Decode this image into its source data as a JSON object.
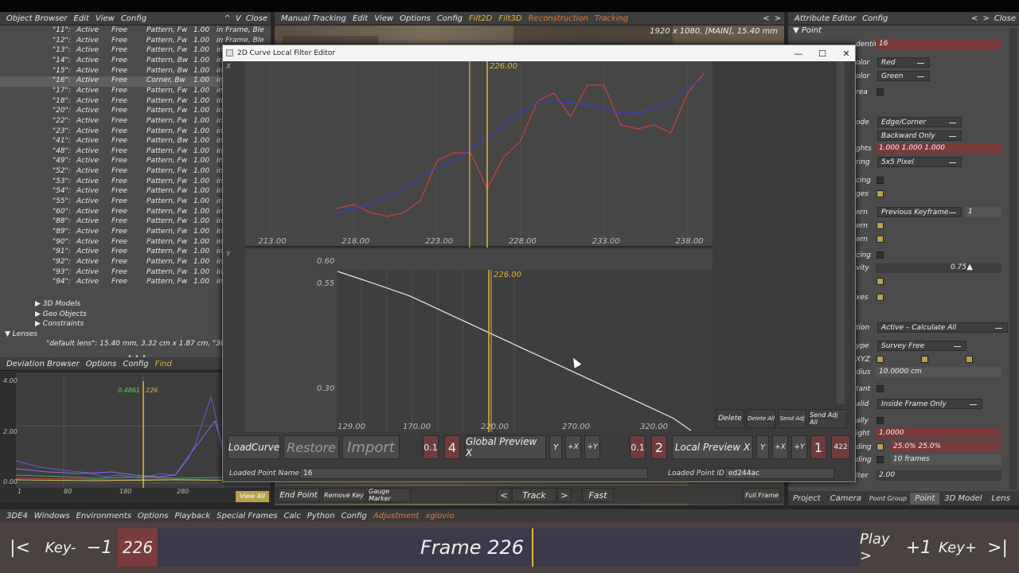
{
  "object_browser": {
    "menu": [
      "Object Browser",
      "Edit",
      "View",
      "Config"
    ],
    "header_right": [
      "^",
      "V",
      "Close"
    ],
    "rows": [
      {
        "id": "\"11\":",
        "status": "Active",
        "mode": "Free",
        "type": "Pattern, Fw",
        "weight": "1.00",
        "extra": "in Frame, Ble"
      },
      {
        "id": "\"12\":",
        "status": "Active",
        "mode": "Free",
        "type": "Pattern, Fw",
        "weight": "1.00",
        "extra": "in Frame, Ble"
      },
      {
        "id": "\"13\":",
        "status": "Active",
        "mode": "Free",
        "type": "Pattern, Fw",
        "weight": "1.00",
        "extra": "in Fr"
      },
      {
        "id": "\"14\":",
        "status": "Active",
        "mode": "Free",
        "type": "Pattern, Bw",
        "weight": "1.00",
        "extra": "in"
      },
      {
        "id": "\"15\":",
        "status": "Active",
        "mode": "Free",
        "type": "Pattern, Bw",
        "weight": "1.00",
        "extra": "in"
      },
      {
        "id": "\"16\":",
        "status": "Active",
        "mode": "Free",
        "type": "Corner, Bw",
        "weight": "1.00",
        "extra": "in",
        "selected": true
      },
      {
        "id": "\"17\":",
        "status": "Active",
        "mode": "Free",
        "type": "Pattern, Fw",
        "weight": "1.00",
        "extra": "in"
      },
      {
        "id": "\"18\":",
        "status": "Active",
        "mode": "Free",
        "type": "Pattern, Fw",
        "weight": "1.00",
        "extra": "in"
      },
      {
        "id": "\"20\":",
        "status": "Active",
        "mode": "Free",
        "type": "Pattern, Fw",
        "weight": "1.00",
        "extra": "in"
      },
      {
        "id": "\"22\":",
        "status": "Active",
        "mode": "Free",
        "type": "Pattern, Fw",
        "weight": "1.00",
        "extra": "in"
      },
      {
        "id": "\"23\":",
        "status": "Active",
        "mode": "Free",
        "type": "Pattern, Fw",
        "weight": "1.00",
        "extra": "in"
      },
      {
        "id": "\"41\":",
        "status": "Active",
        "mode": "Free",
        "type": "Pattern, Bw",
        "weight": "1.00",
        "extra": "in"
      },
      {
        "id": "\"48\":",
        "status": "Active",
        "mode": "Free",
        "type": "Pattern, Fw",
        "weight": "1.00",
        "extra": "in"
      },
      {
        "id": "\"49\":",
        "status": "Active",
        "mode": "Free",
        "type": "Pattern, Fw",
        "weight": "1.00",
        "extra": "in"
      },
      {
        "id": "\"52\":",
        "status": "Active",
        "mode": "Free",
        "type": "Pattern, Fw",
        "weight": "1.00",
        "extra": "in"
      },
      {
        "id": "\"53\":",
        "status": "Active",
        "mode": "Free",
        "type": "Pattern, Fw",
        "weight": "1.00",
        "extra": "in"
      },
      {
        "id": "\"54\":",
        "status": "Active",
        "mode": "Free",
        "type": "Pattern, Fw",
        "weight": "1.00",
        "extra": "in"
      },
      {
        "id": "\"55\":",
        "status": "Active",
        "mode": "Free",
        "type": "Pattern, Fw",
        "weight": "1.00",
        "extra": "in"
      },
      {
        "id": "\"60\":",
        "status": "Active",
        "mode": "Free",
        "type": "Pattern, Fw",
        "weight": "1.00",
        "extra": "in"
      },
      {
        "id": "\"88\":",
        "status": "Active",
        "mode": "Free",
        "type": "Pattern, Fw",
        "weight": "1.00",
        "extra": "in"
      },
      {
        "id": "\"89\":",
        "status": "Active",
        "mode": "Free",
        "type": "Pattern, Fw",
        "weight": "1.00",
        "extra": "in"
      },
      {
        "id": "\"90\":",
        "status": "Active",
        "mode": "Free",
        "type": "Pattern, Fw",
        "weight": "1.00",
        "extra": "in"
      },
      {
        "id": "\"91\":",
        "status": "Active",
        "mode": "Free",
        "type": "Pattern, Fw",
        "weight": "1.00",
        "extra": "in"
      },
      {
        "id": "\"92\":",
        "status": "Active",
        "mode": "Free",
        "type": "Pattern, Fw",
        "weight": "1.00",
        "extra": "in"
      },
      {
        "id": "\"93\":",
        "status": "Active",
        "mode": "Free",
        "type": "Pattern, Fw",
        "weight": "1.00",
        "extra": "in"
      },
      {
        "id": "\"94\":",
        "status": "Active",
        "mode": "Free",
        "type": "Pattern, Fw",
        "weight": "1.00",
        "extra": "in"
      }
    ],
    "tree": [
      "3D Models",
      "Geo Objects",
      "Constraints",
      "Lenses"
    ],
    "lens_line": "\"default lens\": 15.40 mm, 3.32 cm x 1.87 cm, \"3DE4 Radia"
  },
  "deviation_browser": {
    "menu": [
      "Deviation Browser",
      "Options",
      "Config",
      "Find"
    ],
    "y_ticks": [
      "4.00",
      "2.00",
      "0.00"
    ],
    "x_ticks": [
      "1",
      "80",
      "180",
      "280"
    ],
    "cursor_label": "0.4861",
    "cursor_frame": "226",
    "view_all": "View All"
  },
  "manual_tracking": {
    "menu": [
      "Manual Tracking",
      "Edit",
      "View",
      "Options",
      "Config",
      "Filt2D",
      "Filt3D",
      "Reconstruction",
      "Tracking"
    ],
    "info": "1920 x 1080, [MAIN], 15.40 mm",
    "buttons": [
      "End Point",
      "Remove Key",
      "Gauge Marker"
    ],
    "track": "Track",
    "fast": "Fast",
    "full_frame": "Full Frame"
  },
  "attribute_editor": {
    "menu": [
      "Attribute Editor",
      "Config"
    ],
    "section": "Point",
    "identifier_label": "dentifier",
    "identifier": "16",
    "color1_label": "olor",
    "color1": "Red",
    "color2_label": "olor",
    "color2": "Green",
    "area_label": "rea",
    "mode_label": "ode",
    "mode": "Edge/Corner",
    "direction": "Backward Only",
    "weights_label": "ghts",
    "weights": "1.000 1.000 1.000",
    "ring_label": "ring",
    "ring": "5x5 Pixel",
    "cing1": "cing",
    "ges": "ges",
    "pattern_label": "ern",
    "pattern": "Previous Keyframe",
    "pattern_num": "1",
    "ern2": "ern",
    "ern3": "ern",
    "cing2": "cing",
    "vity_label": "vity",
    "vity": "0.75",
    "xes": "xes",
    "tion_label": "tion",
    "calc": "Active – Calculate All",
    "ype_label": "ype",
    "survey": "Survey Free",
    "xyz_label": "XYZ",
    "dius_label": "dius",
    "radius": "10.0000 cm",
    "tant_label": "tant",
    "valid_label": "alid",
    "valid": "Inside Frame Only",
    "ally_label": "ally",
    "ight_label": "ight",
    "weight": "1.0000",
    "ding1_label": "ding",
    "ding1": "25.0%  25.0%",
    "ding2_label": "ding",
    "frames": "10 frames",
    "lter_label": "lter",
    "filter": "2.00",
    "tabs": [
      "Project",
      "Camera",
      "Point Group",
      "Point",
      "3D Model",
      "Lens"
    ]
  },
  "bottom_menu": [
    "3DE4",
    "Windows",
    "Environments",
    "Options",
    "Playback",
    "Special Frames",
    "Calc",
    "Python",
    "Config",
    "Adjustment",
    "xgiovio"
  ],
  "timeline": {
    "first": "|<",
    "keyprev": "Key-",
    "minus1": "−1",
    "frame_field": "226",
    "frame_label": "Frame 226",
    "play": "Play >",
    "plus1": "+1",
    "keynext": "Key+",
    "last": ">|"
  },
  "dialog": {
    "title": "2D Curve Local Filter Editor",
    "controls": [
      "—",
      "☐",
      "✕"
    ],
    "x_axis_label": "X",
    "y_axis_label": "Y",
    "plot1_ticks": [
      "213.00",
      "218.00",
      "223.00",
      "228.00",
      "233.00",
      "238.00"
    ],
    "plot1_cursor": "226.00",
    "plot2_ticks_y": [
      "0.60",
      "0.55",
      "0.30"
    ],
    "plot2_ticks_x": [
      "129.00",
      "170.00",
      "220.00",
      "270.00",
      "320.00"
    ],
    "plot2_cursor": "226.00",
    "right_buttons": [
      "Delete",
      "Delete All",
      "Send Adj",
      "Send Adj All"
    ],
    "load_curve": "LoadCurve",
    "restore": "Restore",
    "import": "Import",
    "g_step": "0.1",
    "g_num": "4",
    "global_preview": "Global Preview X",
    "g_y": "Y",
    "g_px": "+X",
    "g_py": "+Y",
    "l_step": "0.1",
    "l_num": "2",
    "local_preview": "Local Preview X",
    "l_y": "Y",
    "l_px": "+X",
    "l_py": "+Y",
    "l_one": "1",
    "l_422": "422",
    "loaded_name_label": "Loaded Point Name",
    "loaded_name": "16",
    "loaded_id_label": "Loaded Point ID",
    "loaded_id": "ed244ac"
  },
  "chart_data": [
    {
      "type": "line",
      "x": [
        213,
        214,
        215,
        216,
        217,
        218,
        219,
        220,
        221,
        222,
        223,
        224,
        225,
        226,
        227,
        228,
        229,
        230,
        231,
        232,
        233,
        234,
        235,
        236,
        237,
        238,
        239
      ],
      "series": [
        {
          "values": [
            null,
            null,
            null,
            null,
            0.35,
            0.4,
            0.3,
            0.25,
            0.3,
            0.45,
            0.95,
            1.05,
            1.05,
            0.6,
            1.0,
            1.2,
            1.7,
            1.8,
            1.5,
            1.9,
            1.9,
            1.4,
            1.35,
            1.4,
            1.3,
            1.8,
            2.05
          ]
        },
        {
          "values": [
            null,
            null,
            null,
            null,
            0.3,
            0.35,
            0.4,
            0.5,
            0.6,
            0.75,
            0.85,
            0.95,
            1.1,
            1.25,
            1.4,
            1.55,
            1.7,
            1.7,
            1.68,
            1.65,
            1.6,
            1.55,
            1.55,
            1.6,
            1.7,
            1.85,
            2.0
          ]
        }
      ],
      "colors": [
        "#d0403f",
        "#3b3bd8"
      ],
      "cursor_x": 226
    },
    {
      "type": "line",
      "x": [
        129,
        150,
        170,
        190,
        210,
        220,
        240,
        260,
        280,
        300,
        320,
        330
      ],
      "values": [
        0.6,
        0.585,
        0.57,
        0.55,
        0.53,
        0.52,
        0.5,
        0.48,
        0.46,
        0.44,
        0.42,
        0.405
      ],
      "ylim": [
        0.3,
        0.6
      ],
      "xlim": [
        120,
        330
      ],
      "cursor_x": 226
    }
  ]
}
